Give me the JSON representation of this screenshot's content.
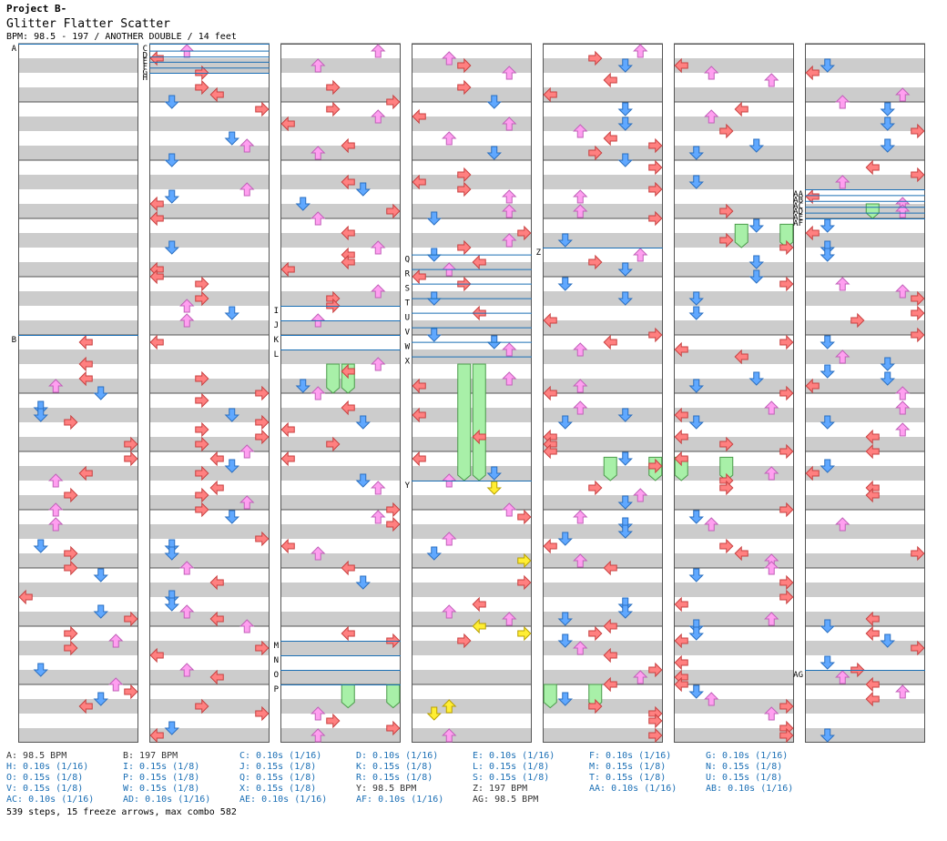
{
  "header": {
    "project": "Project B-",
    "song_title": "Glitter Flatter Scatter",
    "info": "BPM: 98.5 - 197 / ANOTHER DOUBLE / 14 feet"
  },
  "colors": {
    "left": "#ff8080",
    "down": "#60a8ff",
    "up": "#ff9ff0",
    "right": "#ff8080",
    "freeze": "#a8f0a8",
    "marker_line": "#1b6fb5",
    "stripe": "#cccccc",
    "accent_yellow": "#ffee33",
    "accent_green": "#33dd33"
  },
  "chart": {
    "columns": 7,
    "measures_per_column": 12,
    "lanes": 8
  },
  "markers": [
    {
      "label": "A",
      "col": 0,
      "pos": 0.0
    },
    {
      "label": "B",
      "col": 0,
      "pos": 5.0
    },
    {
      "label": "C",
      "col": 1,
      "pos": 0.0
    },
    {
      "label": "D",
      "col": 1,
      "pos": 0.12
    },
    {
      "label": "E",
      "col": 1,
      "pos": 0.22
    },
    {
      "label": "F",
      "col": 1,
      "pos": 0.31
    },
    {
      "label": "G",
      "col": 1,
      "pos": 0.41
    },
    {
      "label": "H",
      "col": 1,
      "pos": 0.5
    },
    {
      "label": "I",
      "col": 2,
      "pos": 4.5
    },
    {
      "label": "J",
      "col": 2,
      "pos": 4.75
    },
    {
      "label": "K",
      "col": 2,
      "pos": 5.0
    },
    {
      "label": "L",
      "col": 2,
      "pos": 5.25
    },
    {
      "label": "M",
      "col": 2,
      "pos": 10.25
    },
    {
      "label": "N",
      "col": 2,
      "pos": 10.5
    },
    {
      "label": "O",
      "col": 2,
      "pos": 10.75
    },
    {
      "label": "P",
      "col": 2,
      "pos": 11.0
    },
    {
      "label": "Q",
      "col": 3,
      "pos": 3.62
    },
    {
      "label": "R",
      "col": 3,
      "pos": 3.87
    },
    {
      "label": "S",
      "col": 3,
      "pos": 4.12
    },
    {
      "label": "T",
      "col": 3,
      "pos": 4.37
    },
    {
      "label": "U",
      "col": 3,
      "pos": 4.62
    },
    {
      "label": "V",
      "col": 3,
      "pos": 4.87
    },
    {
      "label": "W",
      "col": 3,
      "pos": 5.12
    },
    {
      "label": "X",
      "col": 3,
      "pos": 5.37
    },
    {
      "label": "Y",
      "col": 3,
      "pos": 7.5
    },
    {
      "label": "Z",
      "col": 4,
      "pos": 3.5
    },
    {
      "label": "AA",
      "col": 6,
      "pos": 2.5
    },
    {
      "label": "AB",
      "col": 6,
      "pos": 2.6
    },
    {
      "label": "AC",
      "col": 6,
      "pos": 2.7
    },
    {
      "label": "AD",
      "col": 6,
      "pos": 2.8
    },
    {
      "label": "AE",
      "col": 6,
      "pos": 2.9
    },
    {
      "label": "AF",
      "col": 6,
      "pos": 3.0
    },
    {
      "label": "AG",
      "col": 6,
      "pos": 10.75
    }
  ],
  "freezes": [
    {
      "col": 2,
      "lane": 3,
      "start": 5.5,
      "end": 6.0
    },
    {
      "col": 2,
      "lane": 4,
      "start": 5.5,
      "end": 6.0
    },
    {
      "col": 2,
      "lane": 4,
      "start": 11.0,
      "end": 11.4
    },
    {
      "col": 2,
      "lane": 7,
      "start": 11.0,
      "end": 11.4
    },
    {
      "col": 3,
      "lane": 3,
      "start": 5.5,
      "end": 7.5
    },
    {
      "col": 3,
      "lane": 4,
      "start": 5.5,
      "end": 7.5
    },
    {
      "col": 4,
      "lane": 0,
      "start": 11.0,
      "end": 11.4
    },
    {
      "col": 4,
      "lane": 3,
      "start": 11.0,
      "end": 11.4
    },
    {
      "col": 4,
      "lane": 4,
      "start": 7.1,
      "end": 7.5
    },
    {
      "col": 4,
      "lane": 7,
      "start": 7.1,
      "end": 7.5
    },
    {
      "col": 5,
      "lane": 0,
      "start": 7.1,
      "end": 7.5
    },
    {
      "col": 5,
      "lane": 3,
      "start": 7.1,
      "end": 7.5
    },
    {
      "col": 5,
      "lane": 4,
      "start": 3.1,
      "end": 3.5
    },
    {
      "col": 5,
      "lane": 7,
      "start": 3.1,
      "end": 3.5
    },
    {
      "col": 6,
      "lane": 4,
      "start": 2.75,
      "end": 3.0
    }
  ],
  "legend": [
    {
      "text": "A: 98.5 BPM",
      "kind": "bpm"
    },
    {
      "text": "B: 197 BPM",
      "kind": "bpm"
    },
    {
      "text": "C: 0.10s (1/16)",
      "kind": "stop"
    },
    {
      "text": "D: 0.10s (1/16)",
      "kind": "stop"
    },
    {
      "text": "E: 0.10s (1/16)",
      "kind": "stop"
    },
    {
      "text": "F: 0.10s (1/16)",
      "kind": "stop"
    },
    {
      "text": "G: 0.10s (1/16)",
      "kind": "stop"
    },
    {
      "text": "H: 0.10s (1/16)",
      "kind": "stop"
    },
    {
      "text": "I: 0.15s (1/8)",
      "kind": "stop"
    },
    {
      "text": "J: 0.15s (1/8)",
      "kind": "stop"
    },
    {
      "text": "K: 0.15s (1/8)",
      "kind": "stop"
    },
    {
      "text": "L: 0.15s (1/8)",
      "kind": "stop"
    },
    {
      "text": "M: 0.15s (1/8)",
      "kind": "stop"
    },
    {
      "text": "N: 0.15s (1/8)",
      "kind": "stop"
    },
    {
      "text": "O: 0.15s (1/8)",
      "kind": "stop"
    },
    {
      "text": "P: 0.15s (1/8)",
      "kind": "stop"
    },
    {
      "text": "Q: 0.15s (1/8)",
      "kind": "stop"
    },
    {
      "text": "R: 0.15s (1/8)",
      "kind": "stop"
    },
    {
      "text": "S: 0.15s (1/8)",
      "kind": "stop"
    },
    {
      "text": "T: 0.15s (1/8)",
      "kind": "stop"
    },
    {
      "text": "U: 0.15s (1/8)",
      "kind": "stop"
    },
    {
      "text": "V: 0.15s (1/8)",
      "kind": "stop"
    },
    {
      "text": "W: 0.15s (1/8)",
      "kind": "stop"
    },
    {
      "text": "X: 0.15s (1/8)",
      "kind": "stop"
    },
    {
      "text": "Y: 98.5 BPM",
      "kind": "bpm"
    },
    {
      "text": "Z: 197 BPM",
      "kind": "bpm"
    },
    {
      "text": "AA: 0.10s (1/16)",
      "kind": "stop"
    },
    {
      "text": "AB: 0.10s (1/16)",
      "kind": "stop"
    },
    {
      "text": "AC: 0.10s (1/16)",
      "kind": "stop"
    },
    {
      "text": "AD: 0.10s (1/16)",
      "kind": "stop"
    },
    {
      "text": "AE: 0.10s (1/16)",
      "kind": "stop"
    },
    {
      "text": "AF: 0.10s (1/16)",
      "kind": "stop"
    },
    {
      "text": "AG: 98.5 BPM",
      "kind": "bpm"
    }
  ],
  "summary": "539 steps, 15 freeze arrows, max combo 582"
}
